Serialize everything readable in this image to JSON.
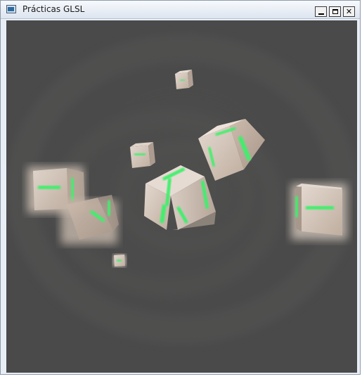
{
  "window": {
    "title": "Prácticas GLSL",
    "icon": "app-window-icon",
    "controls": {
      "minimize": "minimize-icon",
      "maximize": "maximize-icon",
      "close_label": "✕"
    }
  },
  "scene": {
    "background_color": "#4a4a4a",
    "cube_face_color": "#cdbfb4",
    "glow_color": "#33ff66"
  },
  "colors": {
    "titlebar_top": "#f7f9fc",
    "titlebar_bottom": "#dde5f0",
    "frame": "#8e9aa8"
  }
}
